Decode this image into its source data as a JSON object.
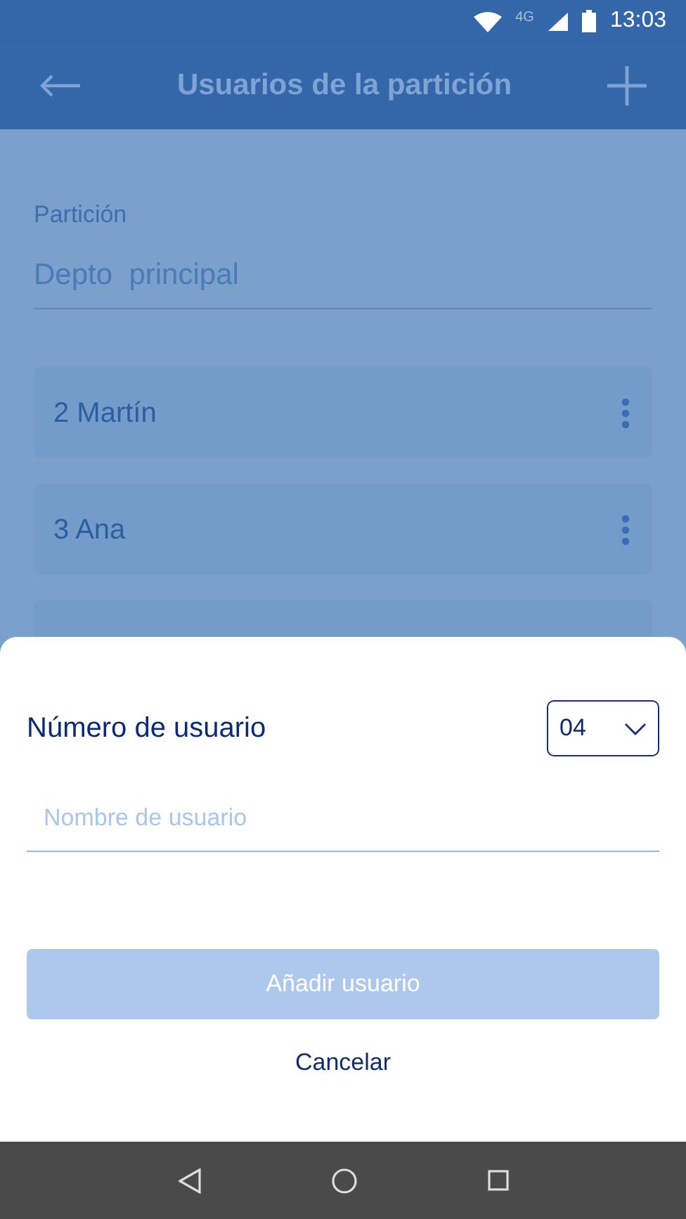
{
  "status_bar": {
    "network": "4G",
    "time": "13:03"
  },
  "app_bar": {
    "title": "Usuarios de la partición"
  },
  "partition": {
    "label": "Partición",
    "value": "Depto  principal"
  },
  "users": [
    {
      "number": "2",
      "name": "Martín"
    },
    {
      "number": "3",
      "name": "Ana"
    }
  ],
  "sheet": {
    "title": "Número de usuario",
    "number_select": {
      "value": "04"
    },
    "name_field": {
      "placeholder": "Nombre de usuario"
    },
    "add_button": {
      "label": "Añadir usuario",
      "disabled": true
    },
    "cancel_button": {
      "label": "Cancelar"
    }
  }
}
